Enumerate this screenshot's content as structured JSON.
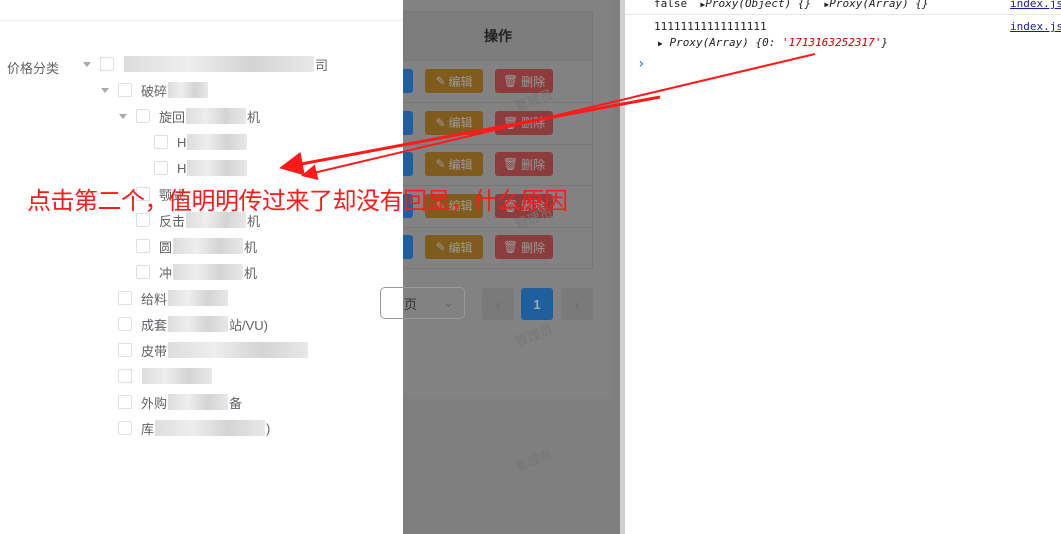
{
  "form": {
    "label": "价格分类"
  },
  "tree": [
    {
      "level": 0,
      "expanded": true,
      "prefix": "",
      "blur": 190,
      "suffix": "司"
    },
    {
      "level": 1,
      "expanded": true,
      "prefix": "破碎",
      "blur": 40,
      "suffix": ""
    },
    {
      "level": 2,
      "expanded": true,
      "prefix": "旋回",
      "blur": 60,
      "suffix": "机"
    },
    {
      "level": 3,
      "prefix": "H",
      "blur": 60,
      "suffix": ""
    },
    {
      "level": 3,
      "prefix": "H",
      "blur": 60,
      "suffix": ""
    },
    {
      "level": 2,
      "prefix": "颚式",
      "blur": 0,
      "suffix": ""
    },
    {
      "level": 2,
      "prefix": "反击",
      "blur": 60,
      "suffix": "机"
    },
    {
      "level": 2,
      "prefix": "圆",
      "blur": 70,
      "suffix": "机"
    },
    {
      "level": 2,
      "prefix": "冲",
      "blur": 70,
      "suffix": "机"
    },
    {
      "level": 1,
      "prefix": "给料",
      "blur": 60,
      "suffix": ""
    },
    {
      "level": 1,
      "prefix": "成套",
      "blur": 60,
      "suffix": "站/VU)"
    },
    {
      "level": 1,
      "prefix": "皮带",
      "blur": 140,
      "suffix": ""
    },
    {
      "level": 1,
      "prefix": "",
      "blur": 70,
      "suffix": ""
    },
    {
      "level": 1,
      "prefix": "外购",
      "blur": 60,
      "suffix": "备"
    },
    {
      "level": 1,
      "prefix": "库",
      "blur": 110,
      "suffix": ")"
    }
  ],
  "table": {
    "header": "操作",
    "edit_label": "编辑",
    "delete_label": "删除",
    "rows": 5
  },
  "pagination": {
    "page_size_suffix": "页",
    "current_page": "1",
    "prev": "‹",
    "next": "›"
  },
  "watermark": "管理员",
  "annotation": "点击第二个，值明明传过来了却没有回显，什么原因",
  "console": {
    "line1": {
      "value": "false",
      "obj1": "Proxy(Object) {}",
      "obj2": "Proxy(Array) {}",
      "source": "index.js"
    },
    "line2": {
      "value": "11111111111111111",
      "source": "index.js"
    },
    "line3": {
      "prefix": "Proxy(Array) {0: ",
      "string": "'1713163252317'",
      "suffix": "}"
    },
    "prompt": "›"
  },
  "colors": {
    "annotation": "#ff1a1a",
    "overlay": "#7f7f7f",
    "primary": "#1f5fa0"
  }
}
